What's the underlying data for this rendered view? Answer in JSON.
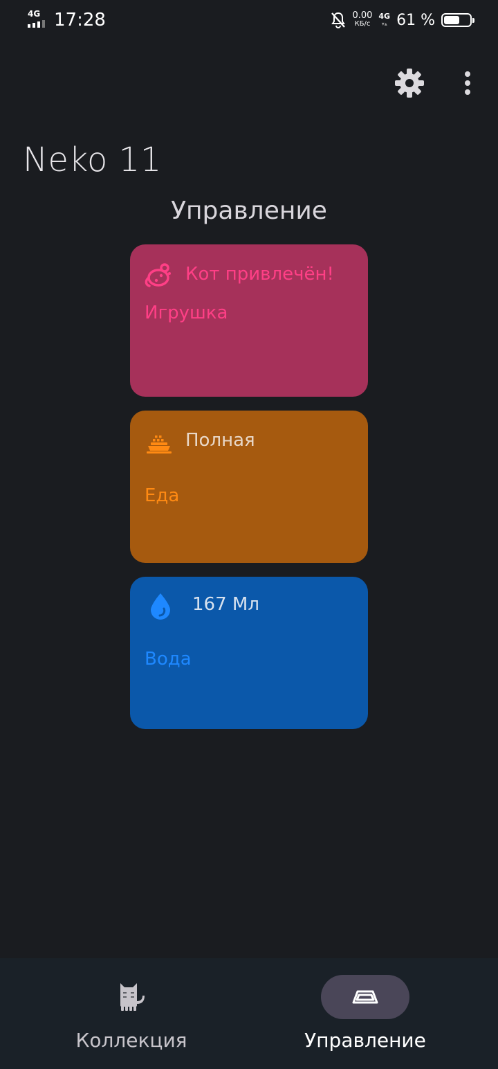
{
  "status_bar": {
    "network": "4G",
    "time": "17:28",
    "speed_value": "0.00",
    "speed_unit": "КБ/с",
    "mobile_data": "4G",
    "battery_text": "61 %",
    "battery_level": 0.61
  },
  "toolbar": {
    "settings_icon": "gear-icon",
    "more_icon": "more-vert-icon"
  },
  "app": {
    "title": "Neko 11"
  },
  "section": {
    "title": "Управление"
  },
  "cards": [
    {
      "icon": "cat-toy-mouse-icon",
      "status": "Кот привлечён!",
      "label": "Игрушка",
      "color": "#a6315a",
      "accent": "#ff3f86"
    },
    {
      "icon": "food-bowl-icon",
      "status": "Полная",
      "label": "Еда",
      "color": "#a65a0f",
      "accent": "#ff8a13"
    },
    {
      "icon": "water-drop-icon",
      "status": "167 Мл",
      "label": "Вода",
      "color": "#0b58aa",
      "accent": "#1e88ff"
    }
  ],
  "bottom_nav": {
    "items": [
      {
        "label": "Коллекция",
        "icon": "cat-icon",
        "selected": false
      },
      {
        "label": "Управление",
        "icon": "bowl-icon",
        "selected": true
      }
    ]
  },
  "colors": {
    "background": "#1a1c20",
    "nav_background": "#1a2128",
    "nav_selected_pill": "#4a4658"
  }
}
